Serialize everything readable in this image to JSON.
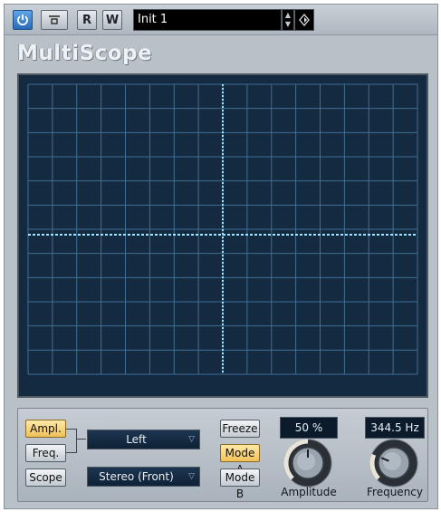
{
  "toolbar": {
    "power_icon": "power-icon",
    "bypass_icon": "bypass-icon",
    "read_label": "R",
    "write_label": "W",
    "preset_name": "Init 1",
    "spin_up": "▲",
    "spin_down": "▼",
    "menu_icon": "preset-menu-icon"
  },
  "plugin": {
    "title": "MultiScope"
  },
  "scope": {
    "grid_color": "#3f6f95",
    "trace_color": "#9fe7ff",
    "background": "#142a40"
  },
  "controls": {
    "ampl_label": "Ampl.",
    "freq_label": "Freq.",
    "scope_label": "Scope",
    "channel_value": "Left",
    "mode_value": "Stereo (Front)",
    "dropdown_arrow": "▽",
    "freeze_label": "Freeze",
    "mode_a_label": "Mode A",
    "mode_b_label": "Mode B",
    "amplitude": {
      "value": "50 %",
      "label": "Amplitude",
      "level": 0.5
    },
    "frequency": {
      "value": "344.5 Hz",
      "label": "Frequency",
      "level": 0.25
    },
    "active_color": "#f0c15a"
  }
}
